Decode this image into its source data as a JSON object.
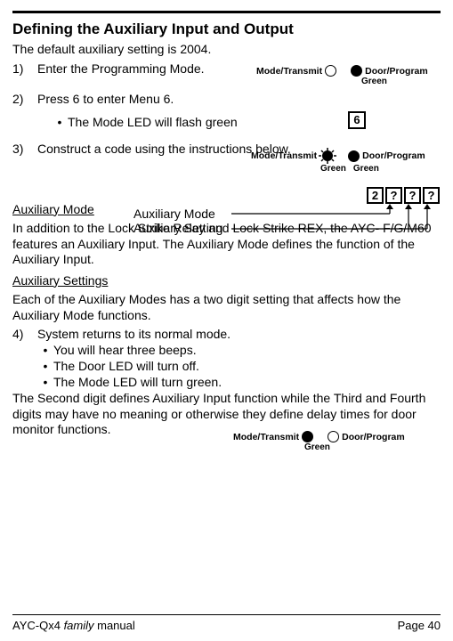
{
  "title": "Defining the Auxiliary Input and Output",
  "intro": "The default auxiliary setting is 2004.",
  "steps": {
    "s1": {
      "num": "1)",
      "text": "Enter the Programming Mode."
    },
    "s2": {
      "num": "2)",
      "text": "Press 6 to enter Menu 6."
    },
    "s2_bullet": "The Mode LED will flash green",
    "s3": {
      "num": "3)",
      "text": "Construct a  code using the instructions below."
    },
    "s4": {
      "num": "4)",
      "text": "System returns to its normal mode."
    },
    "s4_b1": "You will hear three beeps.",
    "s4_b2": "The Door LED will turn off.",
    "s4_b3": "The Mode LED will turn green."
  },
  "aux_mode_label": "Auxiliary Mode",
  "aux_setting_label": "Auxiliary Setting",
  "aux_mode_head": "Auxiliary Mode",
  "aux_mode_body": "In addition to the Lock Strike Relay and Lock Strike REX, the AYC- F/G/M60 features an Auxiliary Input. The Auxiliary Mode defines the function of the Auxiliary Input.",
  "aux_settings_head": "Auxiliary Settings",
  "aux_settings_body": "Each of the Auxiliary Modes has a two digit setting that affects how the Auxiliary Mode functions.",
  "tail_para": "The Second digit defines Auxiliary Input function while the Third and Fourth digits may have no meaning or otherwise they define delay times for door monitor functions.",
  "led": {
    "mode_transmit": "Mode/Transmit",
    "door_program": "Door/Program",
    "green": "Green"
  },
  "key6": "6",
  "code": {
    "d1": "2",
    "d2": "?",
    "d3": "?",
    "d4": "?"
  },
  "footer": {
    "left_a": "AYC-Qx4 ",
    "left_b": "family",
    "left_c": " manual",
    "right": "Page 40"
  }
}
